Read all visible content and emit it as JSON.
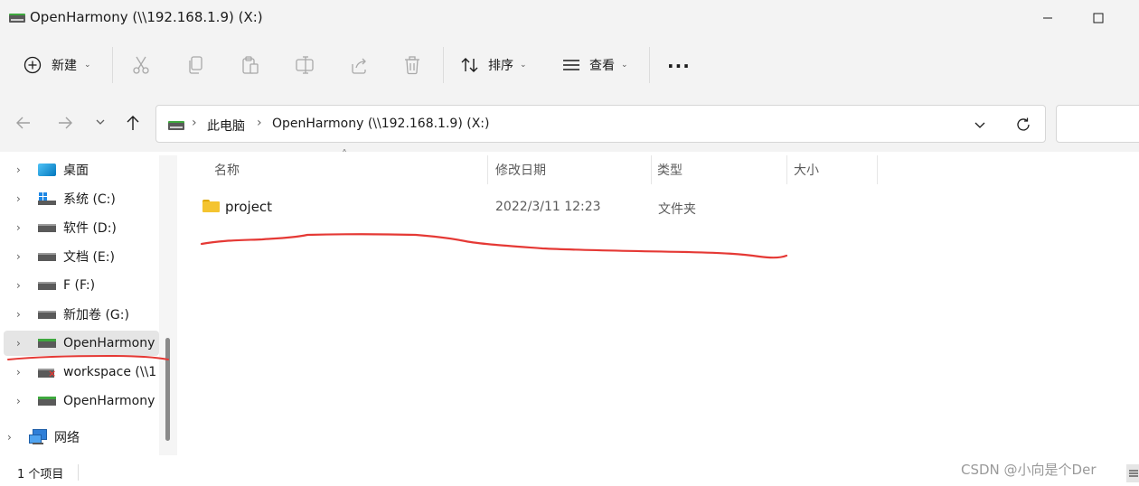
{
  "window": {
    "title": "OpenHarmony (\\\\192.168.1.9) (X:)"
  },
  "toolbar": {
    "new_label": "新建",
    "sort_label": "排序",
    "view_label": "查看",
    "more_label": "..."
  },
  "address": {
    "crumbs": [
      "此电脑",
      "OpenHarmony (\\\\192.168.1.9) (X:)"
    ]
  },
  "sidebar": {
    "items": [
      {
        "label": "桌面",
        "icon": "desktop-icon"
      },
      {
        "label": "系统 (C:)",
        "icon": "windows-drive-icon"
      },
      {
        "label": "软件 (D:)",
        "icon": "drive-icon"
      },
      {
        "label": "文档 (E:)",
        "icon": "drive-icon"
      },
      {
        "label": "F (F:)",
        "icon": "drive-icon"
      },
      {
        "label": "新加卷 (G:)",
        "icon": "drive-icon"
      },
      {
        "label": "OpenHarmony",
        "icon": "network-drive-icon",
        "selected": true
      },
      {
        "label": "workspace (\\\\1",
        "icon": "disconnected-drive-icon"
      },
      {
        "label": "OpenHarmony",
        "icon": "network-drive-icon"
      },
      {
        "label": "网络",
        "icon": "network-icon"
      }
    ]
  },
  "columns": [
    "名称",
    "修改日期",
    "类型",
    "大小"
  ],
  "files": [
    {
      "name": "project",
      "modified": "2022/3/11 12:23",
      "type": "文件夹",
      "size": ""
    }
  ],
  "status": {
    "count": "1 个项目"
  },
  "watermark": "CSDN @小向是个Der",
  "colors": {
    "chrome": "#f3f3f3",
    "annotation": "#e53935",
    "folder": "#f4c430"
  }
}
